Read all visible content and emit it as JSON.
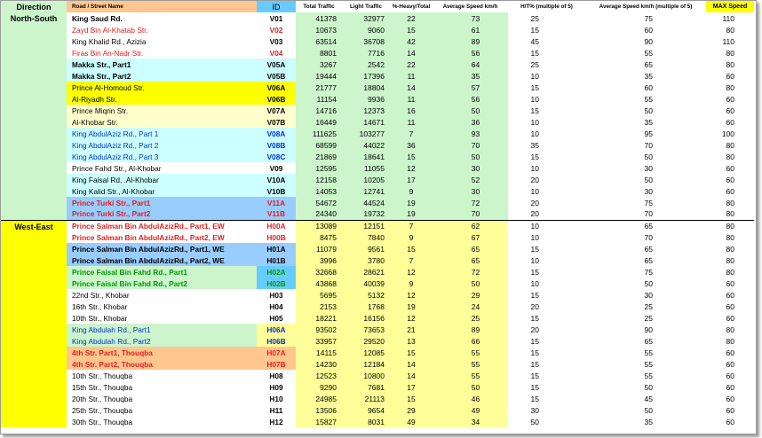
{
  "headers": {
    "direction": "Direction",
    "road": "Road / Street Name",
    "id": "ID",
    "total": "Total Traffic",
    "light": "Light Traffic",
    "heavy": "%-Heavy/Total",
    "speed": "Average Speed km/h",
    "ht": "H/T% (multiple of 5)",
    "avg5": "Average Speed km/h (multiple of 5)",
    "max": "MAX Speed"
  },
  "colors": {
    "green": "#ccf5cc",
    "yellow": "#ffff00",
    "light_yellow": "#ffff99",
    "orange": "#ffc78f",
    "cyan": "#ccffff",
    "blue": "#99ccff",
    "red_text": "#e02020",
    "blue_text": "#0033cc",
    "green_text": "#009900"
  },
  "groups": [
    {
      "direction": "North-South",
      "rows": [
        {
          "name": "King Saud Rd.",
          "id": "V01",
          "total": "41378",
          "light": "32977",
          "heavy": "22",
          "speed": "73",
          "ht": "25",
          "avg5": "75",
          "max": "110",
          "bg": "#ffffff",
          "idbg": "#ffffff",
          "color": "#000000",
          "bold": true
        },
        {
          "name": "Zayd Bin Al-Khatab Str.",
          "id": "V02",
          "total": "10673",
          "light": "9060",
          "heavy": "15",
          "speed": "61",
          "ht": "15",
          "avg5": "60",
          "max": "80",
          "bg": "#ffffff",
          "idbg": "#ffffff",
          "color": "#e02020",
          "bold": false
        },
        {
          "name": "King Khalid Rd., Azizia",
          "id": "V03",
          "total": "63514",
          "light": "36708",
          "heavy": "42",
          "speed": "89",
          "ht": "45",
          "avg5": "90",
          "max": "110",
          "bg": "#ffffff",
          "idbg": "#ffffff",
          "color": "#000000",
          "bold": false
        },
        {
          "name": "Firas Bin An-Nadr Str.",
          "id": "V04",
          "total": "8801",
          "light": "7716",
          "heavy": "14",
          "speed": "56",
          "ht": "15",
          "avg5": "55",
          "max": "80",
          "bg": "#ffffff",
          "idbg": "#ffffff",
          "color": "#e02020",
          "bold": false
        },
        {
          "name": "Makka Str., Part1",
          "id": "V05A",
          "total": "3267",
          "light": "2542",
          "heavy": "22",
          "speed": "64",
          "ht": "25",
          "avg5": "65",
          "max": "80",
          "bg": "#ccffff",
          "idbg": "#ccffff",
          "color": "#000000",
          "bold": true
        },
        {
          "name": "Makka Str., Part2",
          "id": "V05B",
          "total": "19444",
          "light": "17396",
          "heavy": "11",
          "speed": "35",
          "ht": "10",
          "avg5": "35",
          "max": "60",
          "bg": "#ccffff",
          "idbg": "#ccffff",
          "color": "#000000",
          "bold": true
        },
        {
          "name": "Prince Al-Homoud Str.",
          "id": "V06A",
          "total": "21777",
          "light": "18804",
          "heavy": "14",
          "speed": "57",
          "ht": "15",
          "avg5": "60",
          "max": "80",
          "bg": "#ffff00",
          "idbg": "#ffff00",
          "color": "#000000",
          "bold": false
        },
        {
          "name": "Al-Riyadh Str.",
          "id": "V06B",
          "total": "11154",
          "light": "9936",
          "heavy": "11",
          "speed": "56",
          "ht": "10",
          "avg5": "55",
          "max": "60",
          "bg": "#ffff00",
          "idbg": "#ffff00",
          "color": "#000000",
          "bold": false
        },
        {
          "name": "Prince Miqrin Str.",
          "id": "V07A",
          "total": "14716",
          "light": "12373",
          "heavy": "16",
          "speed": "50",
          "ht": "15",
          "avg5": "50",
          "max": "60",
          "bg": "#ffffcc",
          "idbg": "#ffffcc",
          "color": "#000000",
          "bold": false
        },
        {
          "name": "Al-Khobar Str.",
          "id": "V07B",
          "total": "16449",
          "light": "14671",
          "heavy": "11",
          "speed": "36",
          "ht": "10",
          "avg5": "35",
          "max": "60",
          "bg": "#ffffcc",
          "idbg": "#ffffcc",
          "color": "#000000",
          "bold": false
        },
        {
          "name": "King AbdulAziz Rd., Part 1",
          "id": "V08A",
          "total": "111625",
          "light": "103277",
          "heavy": "7",
          "speed": "93",
          "ht": "10",
          "avg5": "95",
          "max": "100",
          "bg": "#ccffff",
          "idbg": "#ccffff",
          "color": "#0033cc",
          "bold": false
        },
        {
          "name": "King AbdulAziz Rd., Part 2",
          "id": "V08B",
          "total": "68599",
          "light": "44022",
          "heavy": "36",
          "speed": "70",
          "ht": "35",
          "avg5": "70",
          "max": "80",
          "bg": "#ccffff",
          "idbg": "#ccffff",
          "color": "#0033cc",
          "bold": false
        },
        {
          "name": "King AbdulAziz Rd., Part 3",
          "id": "V08C",
          "total": "21869",
          "light": "18641",
          "heavy": "15",
          "speed": "50",
          "ht": "15",
          "avg5": "50",
          "max": "80",
          "bg": "#ccffff",
          "idbg": "#ccffff",
          "color": "#0033cc",
          "bold": false
        },
        {
          "name": "Prince Fahd Str., Al-Khobar",
          "id": "V09",
          "total": "12595",
          "light": "11055",
          "heavy": "12",
          "speed": "30",
          "ht": "10",
          "avg5": "30",
          "max": "60",
          "bg": "#ffffff",
          "idbg": "#ffffff",
          "color": "#000000",
          "bold": false
        },
        {
          "name": "King Faisal Rd, .Al-Khobar",
          "id": "V10A",
          "total": "12158",
          "light": "10205",
          "heavy": "17",
          "speed": "52",
          "ht": "20",
          "avg5": "50",
          "max": "60",
          "bg": "#ccffff",
          "idbg": "#ccffff",
          "color": "#000000",
          "bold": false
        },
        {
          "name": "King Kalid Str., Al-Khobar",
          "id": "V10B",
          "total": "14053",
          "light": "12741",
          "heavy": "9",
          "speed": "30",
          "ht": "10",
          "avg5": "30",
          "max": "60",
          "bg": "#ccffff",
          "idbg": "#ccffff",
          "color": "#000000",
          "bold": false
        },
        {
          "name": "Prince Turki Str., Part1",
          "id": "V11A",
          "total": "54672",
          "light": "44524",
          "heavy": "19",
          "speed": "72",
          "ht": "20",
          "avg5": "75",
          "max": "80",
          "bg": "#99ccff",
          "idbg": "#99ccff",
          "color": "#e02020",
          "bold": true
        },
        {
          "name": "Prince Turki Str., Part2",
          "id": "V11B",
          "total": "24340",
          "light": "19732",
          "heavy": "19",
          "speed": "70",
          "ht": "20",
          "avg5": "70",
          "max": "80",
          "bg": "#99ccff",
          "idbg": "#99ccff",
          "color": "#e02020",
          "bold": true
        }
      ]
    },
    {
      "direction": "West-East",
      "rows": [
        {
          "name": "Prince Salman Bin AbdulAzizRd., Part1, EW",
          "id": "H00A",
          "total": "13089",
          "light": "12151",
          "heavy": "7",
          "speed": "62",
          "ht": "10",
          "avg5": "65",
          "max": "80",
          "bg": "#ffffff",
          "idbg": "#ffffff",
          "color": "#e02020",
          "bold": true
        },
        {
          "name": "Prince Salman Bin AbdulAzizRd., Part2, EW",
          "id": "H00B",
          "total": "8475",
          "light": "7840",
          "heavy": "9",
          "speed": "67",
          "ht": "10",
          "avg5": "70",
          "max": "80",
          "bg": "#ffffff",
          "idbg": "#ffffff",
          "color": "#e02020",
          "bold": true
        },
        {
          "name": "Prince Salman Bin AbdulAzizRd., Part1, WE",
          "id": "H01A",
          "total": "11079",
          "light": "9561",
          "heavy": "15",
          "speed": "65",
          "ht": "15",
          "avg5": "65",
          "max": "80",
          "bg": "#99ccff",
          "idbg": "#99ccff",
          "color": "#000000",
          "bold": true
        },
        {
          "name": "Prince Salman Bin AbdulAzizRd., Part2, WE",
          "id": "H01B",
          "total": "3996",
          "light": "3780",
          "heavy": "7",
          "speed": "65",
          "ht": "10",
          "avg5": "65",
          "max": "80",
          "bg": "#99ccff",
          "idbg": "#99ccff",
          "color": "#000000",
          "bold": true
        },
        {
          "name": "Prince Faisal Bin Fahd Rd., Part1",
          "id": "H02A",
          "total": "32668",
          "light": "28621",
          "heavy": "12",
          "speed": "72",
          "ht": "15",
          "avg5": "75",
          "max": "80",
          "bg": "#ccf5cc",
          "idbg": "#66ccff",
          "color": "#009900",
          "bold": true
        },
        {
          "name": "Prince Faisal Bin Fahd Rd., Part2",
          "id": "H02B",
          "total": "43868",
          "light": "40039",
          "heavy": "9",
          "speed": "50",
          "ht": "10",
          "avg5": "50",
          "max": "60",
          "bg": "#ccf5cc",
          "idbg": "#66ccff",
          "color": "#009900",
          "bold": true
        },
        {
          "name": "22nd Str., Khobar",
          "id": "H03",
          "total": "5695",
          "light": "5132",
          "heavy": "12",
          "speed": "29",
          "ht": "15",
          "avg5": "30",
          "max": "60",
          "bg": "#ffffff",
          "idbg": "#ffffff",
          "color": "#000000",
          "bold": false
        },
        {
          "name": "16th Str., Khobar",
          "id": "H04",
          "total": "2153",
          "light": "1768",
          "heavy": "19",
          "speed": "24",
          "ht": "20",
          "avg5": "25",
          "max": "60",
          "bg": "#ffffff",
          "idbg": "#ffffff",
          "color": "#000000",
          "bold": false
        },
        {
          "name": "10th Str., Khobar",
          "id": "H05",
          "total": "18221",
          "light": "16156",
          "heavy": "12",
          "speed": "25",
          "ht": "15",
          "avg5": "25",
          "max": "60",
          "bg": "#ffffff",
          "idbg": "#ffffff",
          "color": "#000000",
          "bold": false
        },
        {
          "name": "King Abdulah Rd., Part1",
          "id": "H06A",
          "total": "93502",
          "light": "73653",
          "heavy": "21",
          "speed": "89",
          "ht": "20",
          "avg5": "90",
          "max": "80",
          "bg": "#ccf5cc",
          "idbg": "#ffff99",
          "color": "#0033cc",
          "bold": false
        },
        {
          "name": "King Abdulah Rd., Part2",
          "id": "H06B",
          "total": "33957",
          "light": "29520",
          "heavy": "13",
          "speed": "66",
          "ht": "15",
          "avg5": "65",
          "max": "80",
          "bg": "#ccf5cc",
          "idbg": "#ffff99",
          "color": "#0033cc",
          "bold": false
        },
        {
          "name": "4th Str. Part1, Thouqba",
          "id": "H07A",
          "total": "14115",
          "light": "12085",
          "heavy": "15",
          "speed": "55",
          "ht": "15",
          "avg5": "55",
          "max": "60",
          "bg": "#ffc78f",
          "idbg": "#ffc78f",
          "color": "#e02020",
          "bold": true
        },
        {
          "name": "4th Str. Part2, Thouqba",
          "id": "H07B",
          "total": "14230",
          "light": "12184",
          "heavy": "14",
          "speed": "55",
          "ht": "15",
          "avg5": "55",
          "max": "60",
          "bg": "#ffc78f",
          "idbg": "#ffc78f",
          "color": "#e02020",
          "bold": true
        },
        {
          "name": "10th Str., Thouqba",
          "id": "H08",
          "total": "12523",
          "light": "10800",
          "heavy": "14",
          "speed": "55",
          "ht": "15",
          "avg5": "55",
          "max": "60",
          "bg": "#ffffff",
          "idbg": "#ffffff",
          "color": "#000000",
          "bold": false
        },
        {
          "name": "15th Str., Thouqba",
          "id": "H09",
          "total": "9290",
          "light": "7681",
          "heavy": "17",
          "speed": "50",
          "ht": "15",
          "avg5": "50",
          "max": "60",
          "bg": "#ffffff",
          "idbg": "#ffffff",
          "color": "#000000",
          "bold": false
        },
        {
          "name": "20th Str., Thouqba",
          "id": "H10",
          "total": "24985",
          "light": "21113",
          "heavy": "15",
          "speed": "46",
          "ht": "15",
          "avg5": "45",
          "max": "60",
          "bg": "#ffffff",
          "idbg": "#ffffff",
          "color": "#000000",
          "bold": false
        },
        {
          "name": "25th Str., Thouqba",
          "id": "H11",
          "total": "13506",
          "light": "9654",
          "heavy": "29",
          "speed": "49",
          "ht": "30",
          "avg5": "50",
          "max": "60",
          "bg": "#ffffff",
          "idbg": "#ffffff",
          "color": "#000000",
          "bold": false
        },
        {
          "name": "30th Str., Thouqba",
          "id": "H12",
          "total": "15827",
          "light": "8031",
          "heavy": "49",
          "speed": "34",
          "ht": "50",
          "avg5": "35",
          "max": "60",
          "bg": "#ffffff",
          "idbg": "#ffffff",
          "color": "#000000",
          "bold": false
        }
      ]
    }
  ]
}
